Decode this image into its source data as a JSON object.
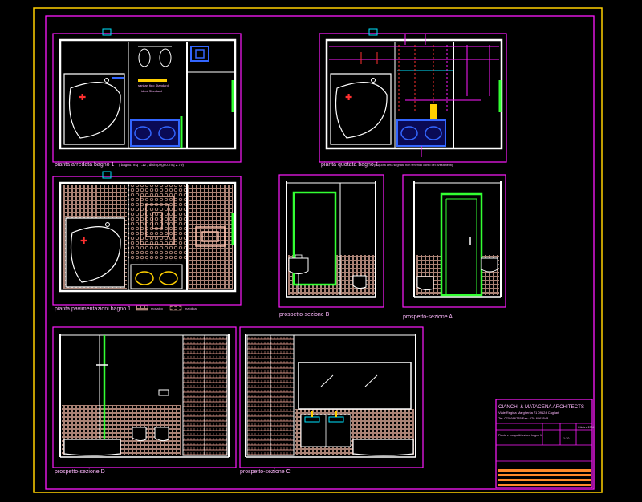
{
  "colors": {
    "frame": "#ff1aff",
    "outer": "#ffd000",
    "wall": "#ffffff",
    "green": "#33ff33",
    "blue": "#3366ff",
    "cyan": "#00e5ff",
    "red": "#ff3030",
    "tile": "#f2b9a6",
    "wood": "#ffb0a0",
    "text": "#ffb8ff"
  },
  "panels": {
    "p1": {
      "title": "pianta arredata bagno 1",
      "subtitle": "( bagno: mq 7.12 ; disimpegno: mq 2.79)",
      "note1": "sanitari tipo Standard",
      "note2": "ideal Standard"
    },
    "p2": {
      "title": "pianta quotata bagno 1",
      "subtitle": "(la quota aera segnata non tenendo conto dei rivestimenti)"
    },
    "p3": {
      "title": "pianta pavimentazioni bagno 1",
      "legend1": "mosaico",
      "legend2": "maiolica"
    },
    "p4": {
      "title": "prospetto-sezione B"
    },
    "p5": {
      "title": "prospetto-sezione A"
    },
    "p6": {
      "title": "prospetto-sezione D"
    },
    "p7": {
      "title": "prospetto-sezione C"
    }
  },
  "titleblock": {
    "firm": "CIANCHI & MATACENA ARCHITECTS",
    "address": "Viale Regina Margherita 71 09124 Cagliari",
    "contacts": "Tel: 070-666735 Fax: 070-6663543",
    "date": "Ottobre 2004",
    "scale": "1:20",
    "drawing": "Pianta e prospetti/sezione bagno 1"
  }
}
